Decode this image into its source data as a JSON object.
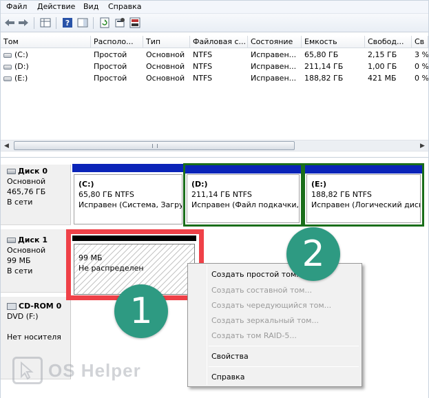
{
  "menubar": {
    "items": [
      "Файл",
      "Действие",
      "Вид",
      "Справка"
    ]
  },
  "toolbar": {
    "buttons": [
      "back-arrow-icon",
      "forward-arrow-icon",
      "grid-view-icon",
      "help-icon",
      "panel-icon",
      "refresh-icon",
      "properties-icon",
      "properties-icon-2"
    ]
  },
  "volume_table": {
    "columns": [
      "Том",
      "Располо...",
      "Тип",
      "Файловая с...",
      "Состояние",
      "Емкость",
      "Свобод...",
      "Св"
    ],
    "rows": [
      [
        "(C:)",
        "Простой",
        "Основной",
        "NTFS",
        "Исправен...",
        "65,80 ГБ",
        "2,15 ГБ",
        "3 %"
      ],
      [
        "(D:)",
        "Простой",
        "Основной",
        "NTFS",
        "Исправен...",
        "211,14 ГБ",
        "1,00 ГБ",
        "0 %"
      ],
      [
        "(E:)",
        "Простой",
        "Основной",
        "NTFS",
        "Исправен...",
        "188,82 ГБ",
        "421 МБ",
        "0 %"
      ]
    ]
  },
  "disks": [
    {
      "name": "Диск 0",
      "type": "Основной",
      "size": "465,76 ГБ",
      "status": "В сети",
      "volumes": [
        {
          "title": "(C:)",
          "size": "65,80 ГБ NTFS",
          "status": "Исправен (Система, Загру"
        },
        {
          "title": "(D:)",
          "size": "211,14 ГБ NTFS",
          "status": "Исправен (Файл подкачки, Л"
        },
        {
          "title": "(E:)",
          "size": "188,82 ГБ NTFS",
          "status": "Исправен (Логический диск)"
        }
      ]
    },
    {
      "name": "Диск 1",
      "type": "Основной",
      "size": "99 МБ",
      "status": "В сети",
      "unallocated": {
        "size": "99 МБ",
        "status": "Не распределен"
      }
    },
    {
      "name": "CD-ROM 0",
      "type": "DVD (F:)",
      "status": "Нет носителя"
    }
  ],
  "context_menu": {
    "items": [
      {
        "label": "Создать простой том...",
        "enabled": true
      },
      {
        "label": "Создать составной том...",
        "enabled": false
      },
      {
        "label": "Создать чередующийся том...",
        "enabled": false
      },
      {
        "label": "Создать зеркальный том...",
        "enabled": false
      },
      {
        "label": "Создать том RAID-5...",
        "enabled": false
      },
      {
        "label": "Свойства",
        "enabled": true
      },
      {
        "label": "Справка",
        "enabled": true
      }
    ]
  },
  "annotations": {
    "badge1": "1",
    "badge2": "2",
    "highlight_color": "#ef4148",
    "badge_color": "#2e9a82"
  },
  "colors": {
    "primary_partition_bar": "#0a24b8",
    "unallocated_bar": "#000000",
    "selected_outline": "#1a6e1a"
  }
}
